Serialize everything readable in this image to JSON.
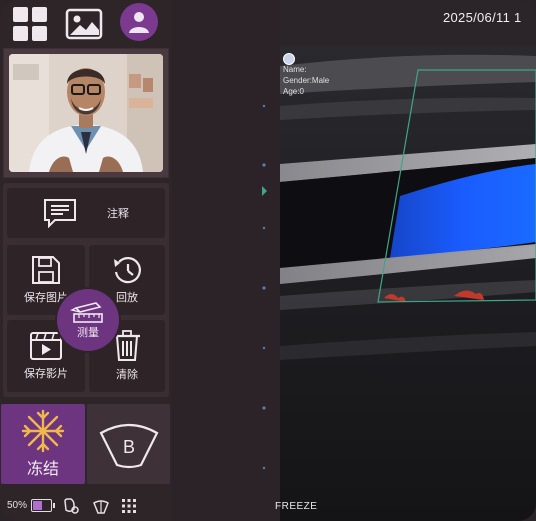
{
  "header": {
    "datetime": "2025/06/11  1"
  },
  "patient": {
    "name_label": "Name:",
    "gender_label": "Gender:Male",
    "age_label": "Age:0"
  },
  "toolbar": {
    "top_icons": [
      "grid-icon",
      "image-gallery-icon",
      "user-profile-icon"
    ]
  },
  "actions": {
    "annotate_label": "注释",
    "save_image_label": "保存图片",
    "playback_label": "回放",
    "measure_label": "测量",
    "save_video_label": "保存影片",
    "clear_label": "清除",
    "freeze_label": "冻结",
    "bmode_label": "B"
  },
  "footer": {
    "battery_percent": "50%",
    "battery_level": 0.5,
    "status_text": "FREEZE"
  },
  "colors": {
    "accent": "#6d3480",
    "panel_bg": "#2e2529",
    "doppler_blue": "#1a5cff",
    "roi_green": "#3fa58a",
    "freeze_icon": "#f0b84a"
  }
}
